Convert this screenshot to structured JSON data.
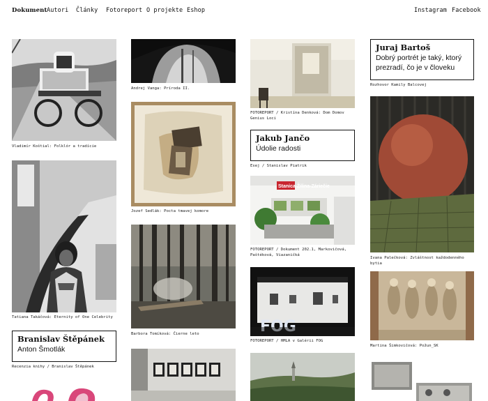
{
  "nav": {
    "brand": "Dokument",
    "items": [
      "Autori",
      "Články",
      "Fotoreport",
      "O projekte",
      "Eshop"
    ],
    "social": [
      "Instagram",
      "Facebook"
    ]
  },
  "columns": {
    "col1": {
      "cap1": "Vladimír Koštial: Folklór a tradície",
      "cap2": "Tatiana Takáčová: Eternity of One Celebrity",
      "box_title": "Branislav Štěpánek",
      "box_sub": "Anton Šmotlák",
      "cap3": "Recenzia knihy / Branislav Štěpánek"
    },
    "col2": {
      "cap1": "Andrej Vanga: Príroda II.",
      "cap2": "Jozef Sedlák: Pocta tmavej komore",
      "cap3": "Barbora Tomíková: Čierne leto"
    },
    "col3": {
      "cap1": "FOTOREPORT / Kristína Denková: Dom Domov Genius Loci",
      "box_title": "Jakub Jančo",
      "box_sub": "Údolie radosti",
      "cap2": "Esej / Stanislav Piatrik",
      "cap3": "FOTOREPORT / Dokument 202.1, Markovičová, Paštéková, Viazaničká",
      "cap4": "FOTOREPORT / HMLA v Galérii FOG",
      "station_sign": "Stanica Žilina-Záriečie",
      "fog_sign": "FOG"
    },
    "col4": {
      "box_title": "Juraj Bartoš",
      "box_sub": "Dobrý portrét je taký, ktorý prezradí, čo je v človeku",
      "cap1": "Rozhovor Kamily Balcovej",
      "cap2": "Ivana Palečková: Zvláštnost každodenného bytia",
      "cap3": "Martina Šimkovičová: Požun_SK"
    }
  },
  "colors": {
    "text": "#111111",
    "background": "#ffffff",
    "accent_pink": "#d9477a"
  }
}
